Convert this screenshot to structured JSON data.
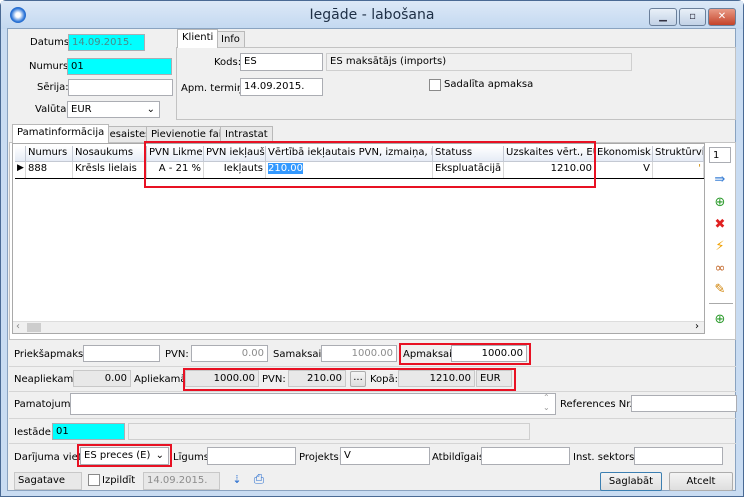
{
  "window": {
    "title": "Iegāde - labošana",
    "minimize": "▁",
    "maximize": "▫",
    "close": "✕"
  },
  "header": {
    "datums_label": "Datums:",
    "datums": "14.09.2015.",
    "numurs_label": "Numurs:",
    "numurs": "01",
    "serija_label": "Sērija:",
    "serija": "",
    "valuta_label": "Valūta:",
    "valuta": "EUR"
  },
  "client_tabs": [
    {
      "label": "Klienti",
      "active": true
    },
    {
      "label": "Info",
      "active": false
    }
  ],
  "client": {
    "kods_label": "Kods:",
    "kods": "ES",
    "kods_name": "ES maksātājs (imports)",
    "apm_label": "Apm. termiņš:",
    "apm": "14.09.2015.",
    "sadalita_label": "Sadalīta apmaksa",
    "sadalita_checked": false
  },
  "main_tabs": [
    {
      "label": "Pamatinformācija",
      "active": true
    },
    {
      "label": "Piesaistes"
    },
    {
      "label": "Pievienotie faili"
    },
    {
      "label": "Intrastat"
    }
  ],
  "grid": {
    "columns": [
      "Numurs",
      "Nosaukums",
      "PVN Likme",
      "PVN iekļauš...",
      "Vērtībā iekļautais PVN, izmaiņa, EUR",
      "Statuss",
      "Uzskaites vērt., EUR",
      "Ekonomisk...",
      "Struktūrvi..."
    ],
    "rows": [
      {
        "numurs": "888",
        "nosaukums": "Krēsls lielais",
        "pvn_likme": "A - 21 %",
        "pvn_iekl": "Iekļauts",
        "vertiba_pvn": "210.00",
        "statuss": "Ekspluatācijā",
        "uzskaites": "1210.00",
        "ekonomisk": "V",
        "strukturv": "'"
      }
    ]
  },
  "toolbar": {
    "counter": "1",
    "icons": [
      "move-to-icon",
      "add-from-template-icon",
      "delete-icon",
      "lightning-icon",
      "view-glasses-icon",
      "edit-pencil-icon",
      "add-document-icon"
    ]
  },
  "totals": {
    "priekspapmaksa_label": "Priekšapmaksa:",
    "priekspapmaksa": "",
    "pvn1_label": "PVN:",
    "pvn1": "0.00",
    "samaksai_label": "Samaksai:",
    "samaksai": "1000.00",
    "apmaksai_label": "Apmaksai:",
    "apmaksai": "1000.00",
    "neapliekama_label": "Neapliekamā:",
    "neapliekama": "0.00",
    "apliekama_label": "Apliekamā:",
    "apliekama": "1000.00",
    "pvn2_label": "PVN:",
    "pvn2": "210.00",
    "ellipsis": "...",
    "kopa_label": "Kopā:",
    "kopa": "1210.00",
    "kopa_currency": "EUR"
  },
  "details": {
    "pamatojums_label": "Pamatojums:",
    "pamatojums": "",
    "references_label": "References Nr.:",
    "references": "",
    "iestade_label": "Iestāde:",
    "iestade": "01",
    "iestade_name": "",
    "darijuma_label": "Darījuma vieta:",
    "darijuma": "ES preces (E)",
    "ligums_label": "Līgums:",
    "ligums": "",
    "projekts_label": "Projekts:",
    "projekts": "V",
    "atbildigais_label": "Atbildīgais:",
    "atbildigais": "",
    "inst_label": "Inst. sektors:",
    "inst": ""
  },
  "footer": {
    "status": "Sagatave",
    "izpildit_label": "Izpildīt",
    "izpildit_checked": false,
    "date": "14.09.2015.",
    "save": "Saglabāt",
    "cancel": "Atcelt"
  }
}
